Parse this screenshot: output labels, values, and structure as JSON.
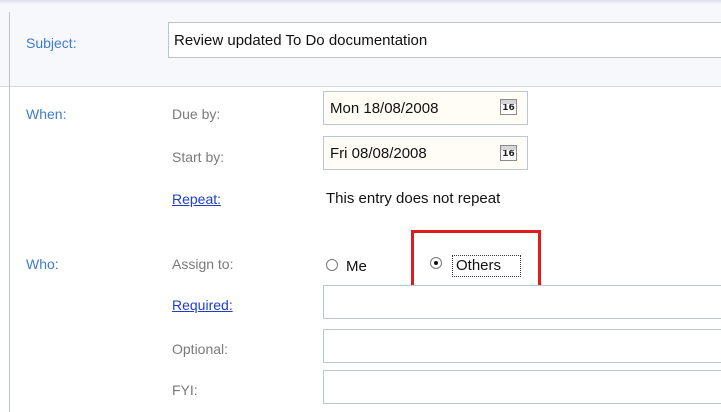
{
  "subject": {
    "label": "Subject:",
    "value": "Review updated To Do documentation"
  },
  "when": {
    "section_label": "When:",
    "due_by": {
      "label": "Due by:",
      "value": "Mon 18/08/2008",
      "calendar_glyph": "16"
    },
    "start_by": {
      "label": "Start by:",
      "value": "Fri 08/08/2008",
      "calendar_glyph": "16"
    },
    "repeat": {
      "label": "Repeat:",
      "status": "This entry does not repeat"
    }
  },
  "who": {
    "section_label": "Who:",
    "assign_to": {
      "label": "Assign to:",
      "options": [
        {
          "label": "Me",
          "selected": false
        },
        {
          "label": "Others",
          "selected": true
        }
      ]
    },
    "required": {
      "label": "Required:",
      "value": ""
    },
    "optional": {
      "label": "Optional:",
      "value": ""
    },
    "fyi": {
      "label": "FYI:",
      "value": ""
    }
  },
  "colors": {
    "section_label": "#3d7cc9",
    "link": "#1f3ec7",
    "highlight": "#e01b1b",
    "field_label": "#7a7a7a"
  },
  "icons": [
    "calendar-icon",
    "radio-button"
  ]
}
